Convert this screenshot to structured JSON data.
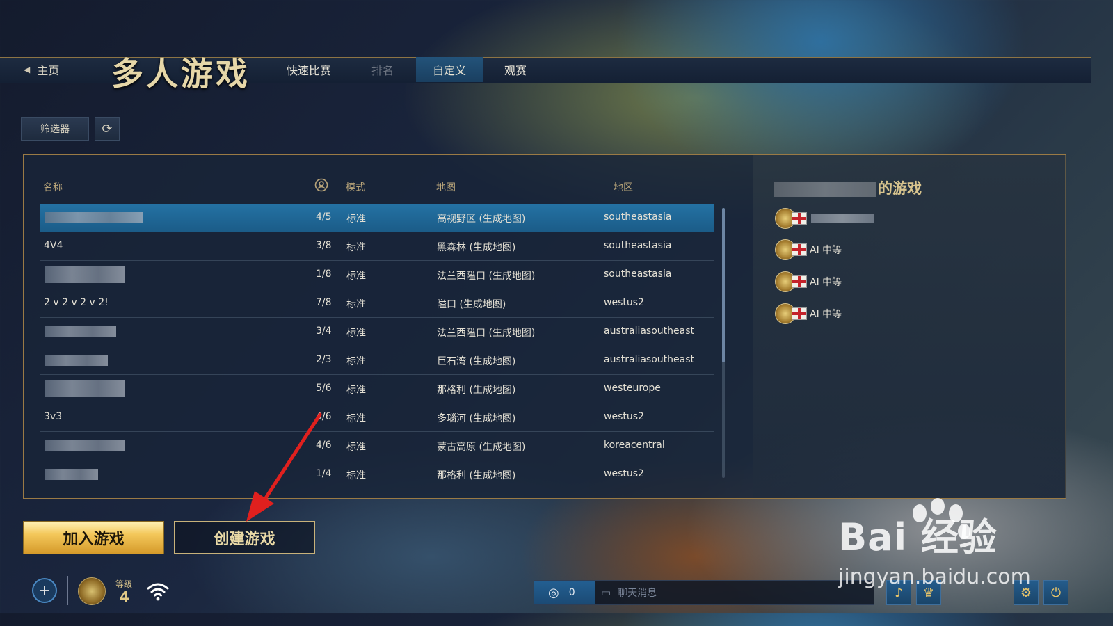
{
  "header": {
    "home_label": "主页",
    "title": "多人游戏",
    "tabs": [
      {
        "label": "快速比赛",
        "state": "normal"
      },
      {
        "label": "排名",
        "state": "disabled"
      },
      {
        "label": "自定义",
        "state": "active"
      },
      {
        "label": "观赛",
        "state": "normal"
      }
    ]
  },
  "toolbar": {
    "filter_label": "筛选器",
    "refresh_icon": "refresh-icon"
  },
  "lobby_list": {
    "columns": [
      "名称",
      "players-icon",
      "模式",
      "地图",
      "地区"
    ],
    "rows": [
      {
        "name": "",
        "players": "4/5",
        "mode": "标准",
        "map": "高视野区 (生成地图)",
        "region": "southeastasia",
        "selected": true
      },
      {
        "name": "4V4",
        "players": "3/8",
        "mode": "标准",
        "map": "黑森林 (生成地图)",
        "region": "southeastasia",
        "selected": false
      },
      {
        "name": "",
        "players": "1/8",
        "mode": "标准",
        "map": "法兰西隘口 (生成地图)",
        "region": "southeastasia",
        "selected": false
      },
      {
        "name": "2 v 2 v 2 v 2!",
        "players": "7/8",
        "mode": "标准",
        "map": "隘口 (生成地图)",
        "region": "westus2",
        "selected": false
      },
      {
        "name": "",
        "players": "3/4",
        "mode": "标准",
        "map": "法兰西隘口 (生成地图)",
        "region": "australiasoutheast",
        "selected": false
      },
      {
        "name": "",
        "players": "2/3",
        "mode": "标准",
        "map": "巨石湾 (生成地图)",
        "region": "australiasoutheast",
        "selected": false
      },
      {
        "name": "",
        "players": "5/6",
        "mode": "标准",
        "map": "那格利 (生成地图)",
        "region": "westeurope",
        "selected": false
      },
      {
        "name": "3v3",
        "players": "4/6",
        "mode": "标准",
        "map": "多瑙河 (生成地图)",
        "region": "westus2",
        "selected": false
      },
      {
        "name": "",
        "players": "4/6",
        "mode": "标准",
        "map": "蒙古高原 (生成地图)",
        "region": "koreacentral",
        "selected": false
      },
      {
        "name": "",
        "players": "1/4",
        "mode": "标准",
        "map": "那格利 (生成地图)",
        "region": "westus2",
        "selected": false
      }
    ]
  },
  "game_panel": {
    "title_suffix": "的游戏",
    "players": [
      {
        "name": "",
        "type": "host"
      },
      {
        "name": "AI 中等",
        "type": "ai"
      },
      {
        "name": "AI 中等",
        "type": "ai"
      },
      {
        "name": "AI 中等",
        "type": "ai"
      }
    ]
  },
  "actions": {
    "join_label": "加入游戏",
    "create_label": "创建游戏"
  },
  "footer": {
    "level_label": "等级",
    "level_value": "4",
    "online_count": "0",
    "chat_placeholder": "聊天消息"
  },
  "watermark": {
    "line1": "Bai 经验",
    "line2": "jingyan.baidu.com"
  },
  "colors": {
    "accent_gold": "#9a7a45",
    "selected_row": "#2472a4",
    "annotation_arrow": "#e0201e"
  }
}
